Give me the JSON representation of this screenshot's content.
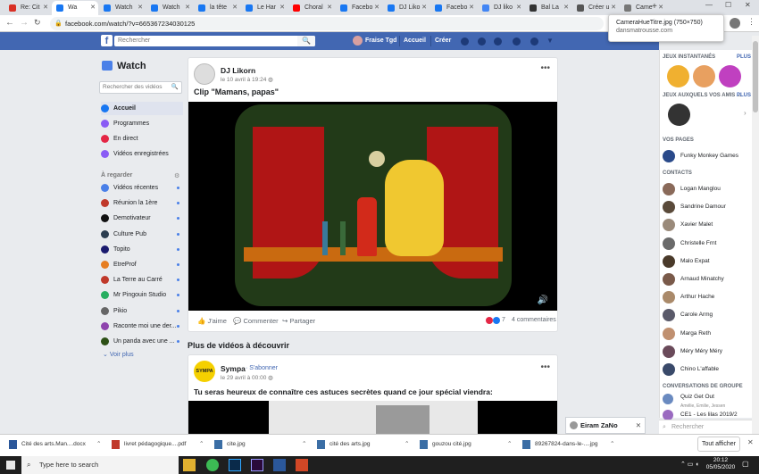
{
  "browser": {
    "tabs": [
      {
        "label": "Re: Cit",
        "color": "#d93025"
      },
      {
        "label": "Wa",
        "color": "#1877f2"
      },
      {
        "label": "Watch",
        "color": "#1877f2"
      },
      {
        "label": "Watch",
        "color": "#1877f2"
      },
      {
        "label": "la tête",
        "color": "#1877f2"
      },
      {
        "label": "Le Har",
        "color": "#1877f2"
      },
      {
        "label": "Choral",
        "color": "#ff0000"
      },
      {
        "label": "Facebo",
        "color": "#1877f2"
      },
      {
        "label": "DJ Liko",
        "color": "#1877f2"
      },
      {
        "label": "Facebo",
        "color": "#1877f2"
      },
      {
        "label": "DJ liko",
        "color": "#4285f4"
      },
      {
        "label": "Bal La",
        "color": "#333333"
      },
      {
        "label": "Créer u",
        "color": "#555555"
      },
      {
        "label": "Came",
        "color": "#777777"
      }
    ],
    "url": "facebook.com/watch/?v=665367234030125",
    "tooltip_title": "CameraHueTitre.jpg (750×750)",
    "tooltip_domain": "dansmatrousse.com"
  },
  "header": {
    "search_placeholder": "Rechercher",
    "user_name": "Fraise Tgd",
    "home_label": "Accueil",
    "create_label": "Créer"
  },
  "sidebar": {
    "title": "Watch",
    "search_placeholder": "Rechercher des vidéos",
    "main_items": [
      {
        "label": "Accueil",
        "color": "#1877f2"
      },
      {
        "label": "Programmes",
        "color": "#8a5cf5"
      },
      {
        "label": "En direct",
        "color": "#e42645"
      },
      {
        "label": "Vidéos enregistrées",
        "color": "#8a5cf5"
      }
    ],
    "section_label": "À regarder",
    "watch_items": [
      {
        "label": "Vidéos récentes",
        "color": "#4a80e8"
      },
      {
        "label": "Réunion la 1ère",
        "color": "#c0392b"
      },
      {
        "label": "Demotivateur",
        "color": "#111111"
      },
      {
        "label": "Culture Pub",
        "color": "#2c3e50"
      },
      {
        "label": "Topito",
        "color": "#1a1a6e"
      },
      {
        "label": "EtreProf",
        "color": "#e67e22"
      },
      {
        "label": "La Terre au Carré",
        "color": "#c0392b"
      },
      {
        "label": "Mr Pingouin Studio",
        "color": "#27ae60"
      },
      {
        "label": "Pikio",
        "color": "#666666"
      },
      {
        "label": "Raconte moi une der...",
        "color": "#8e44ad"
      },
      {
        "label": "Un panda avec une ...",
        "color": "#2d5016"
      }
    ],
    "see_more": "Voir plus"
  },
  "post1": {
    "author": "DJ Likorn",
    "date": "le 10 avril à 19:24",
    "title": "Clip \"Mamans, papas\"",
    "like_label": "J'aime",
    "comment_label": "Commenter",
    "share_label": "Partager",
    "reaction_count": "7",
    "comments_count": "4 commentaires"
  },
  "section_more": "Plus de vidéos à découvrir",
  "post2": {
    "author": "Sympa",
    "subscribe": "S'abonner",
    "logo_text": "SYMPA",
    "date": "le 29 avril à 00:00",
    "title": "Tu seras heureux de connaître ces astuces secrètes quand ce jour spécial viendra:"
  },
  "right": {
    "stories_label": "JEUX INSTANTANÉS",
    "more1": "PLUS",
    "games_label": "JEUX AUXQUELS VOS AMIS ...",
    "more2": "PLUS",
    "pages_label": "VOS PAGES",
    "page_name": "Funky Monkey Games",
    "contacts_label": "CONTACTS",
    "contacts": [
      "Logan Manglou",
      "Sandrine Damour",
      "Xavier Malet",
      "Christelle Frnt",
      "Malo Expat",
      "Arnaud Minatchy",
      "Arthur Hache",
      "Carole Armg",
      "Marga Reth",
      "Méry Méry Méry",
      "Chino L'affable"
    ],
    "groups_label": "CONVERSATIONS DE GROUPE",
    "group1": "Quiz Get Out",
    "group1_members": "Amélie, Emilie, Jessen",
    "group2": "CE1 - Les lilas 2019/2",
    "search_placeholder": "Rechercher",
    "chat_name": "Eiram ZaNo"
  },
  "downloads": {
    "items": [
      {
        "name": "Cité des arts.Man....docx",
        "color": "#2b579a"
      },
      {
        "name": "livret pédagogique....pdf",
        "color": "#c0392b"
      },
      {
        "name": "cite.jpg",
        "color": "#3b6ea5"
      },
      {
        "name": "cité des arts.jpg",
        "color": "#3b6ea5"
      },
      {
        "name": "gouzou cité.jpg",
        "color": "#3b6ea5"
      },
      {
        "name": "89267824-dans-le-....jpg",
        "color": "#3b6ea5"
      }
    ],
    "show_all": "Tout afficher"
  },
  "taskbar": {
    "search_placeholder": "Type here to search",
    "time": "20:12",
    "date": "05/05/2020"
  }
}
